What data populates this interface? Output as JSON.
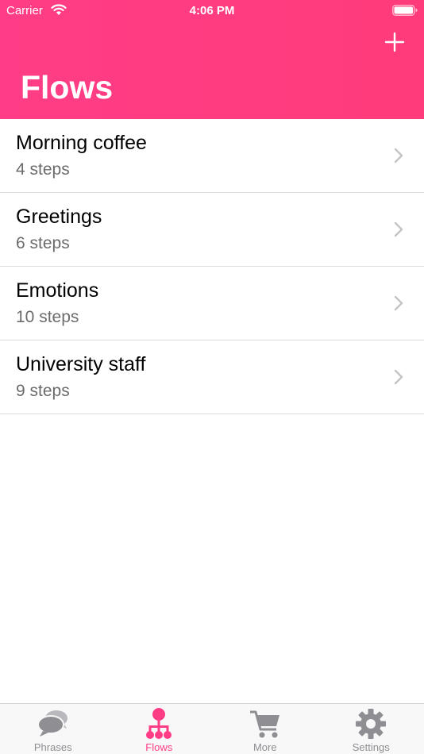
{
  "status_bar": {
    "carrier": "Carrier",
    "time": "4:06 PM"
  },
  "header": {
    "title": "Flows",
    "add_icon": "plus-icon",
    "background_color": "#ff3d86"
  },
  "flows": [
    {
      "title": "Morning coffee",
      "subtitle": "4 steps"
    },
    {
      "title": "Greetings",
      "subtitle": "6 steps"
    },
    {
      "title": "Emotions",
      "subtitle": "10 steps"
    },
    {
      "title": "University staff",
      "subtitle": "9 steps"
    }
  ],
  "tab_bar": {
    "active_color": "#ff3d86",
    "inactive_color": "#8e8e93",
    "tabs": [
      {
        "label": "Phrases",
        "icon": "speech-bubbles-icon",
        "active": false
      },
      {
        "label": "Flows",
        "icon": "flow-tree-icon",
        "active": true
      },
      {
        "label": "More",
        "icon": "cart-icon",
        "active": false
      },
      {
        "label": "Settings",
        "icon": "gear-icon",
        "active": false
      }
    ]
  }
}
